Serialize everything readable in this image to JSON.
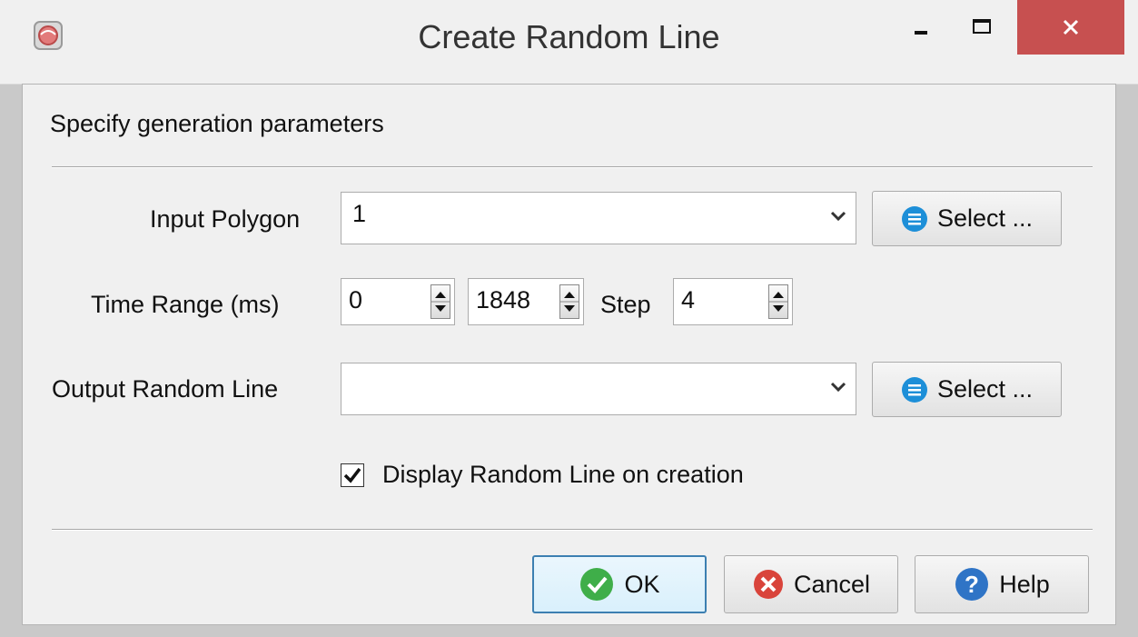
{
  "window": {
    "title": "Create Random Line"
  },
  "instruction": "Specify generation parameters",
  "input_polygon": {
    "label": "Input Polygon",
    "value": "1",
    "select_label": "Select ..."
  },
  "time_range": {
    "label": "Time Range (ms)",
    "start": "0",
    "end": "1848",
    "step_label": "Step",
    "step": "4"
  },
  "output_random_line": {
    "label": "Output Random Line",
    "value": "",
    "select_label": "Select ..."
  },
  "display_option": {
    "label": "Display Random Line on creation",
    "checked": true
  },
  "buttons": {
    "ok": "OK",
    "cancel": "Cancel",
    "help": "Help"
  },
  "colors": {
    "close_button": "#c75050",
    "ok_icon": "#3fae49",
    "cancel_icon": "#d9443b",
    "help_icon": "#2f74c6",
    "select_icon": "#1d8fd8"
  }
}
